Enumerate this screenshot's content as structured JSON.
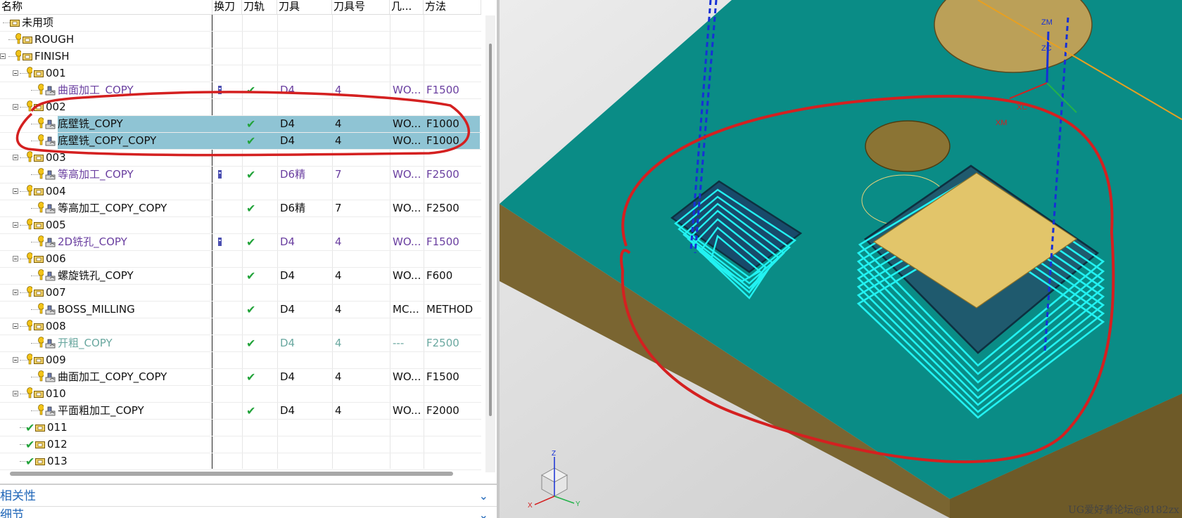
{
  "navigator": {
    "columns": [
      "名称",
      "换刀",
      "刀轨",
      "刀具",
      "刀具号",
      "几...",
      "方法"
    ],
    "rows": [
      {
        "name": "未用项",
        "level": 0,
        "expand": false,
        "bulb": false,
        "check": false,
        "kind": "folder",
        "color": "black",
        "tool_change": false,
        "path_ok": false,
        "tool": "",
        "tool_no": "",
        "geom": "",
        "method": ""
      },
      {
        "name": "ROUGH",
        "level": 1,
        "expand": false,
        "bulb": true,
        "check": false,
        "kind": "folder",
        "color": "black",
        "tool_change": false,
        "path_ok": false,
        "tool": "",
        "tool_no": "",
        "geom": "",
        "method": ""
      },
      {
        "name": "FINISH",
        "level": 1,
        "expand": true,
        "bulb": true,
        "check": false,
        "kind": "folder",
        "color": "black",
        "tool_change": false,
        "path_ok": false,
        "tool": "",
        "tool_no": "",
        "geom": "",
        "method": ""
      },
      {
        "name": "001",
        "level": 2,
        "expand": true,
        "bulb": true,
        "check": false,
        "kind": "folder",
        "color": "black",
        "tool_change": false,
        "path_ok": false,
        "tool": "",
        "tool_no": "",
        "geom": "",
        "method": ""
      },
      {
        "name": "曲面加工_COPY",
        "level": 3,
        "expand": false,
        "bulb": true,
        "check": false,
        "kind": "op",
        "color": "purple",
        "tool_change": true,
        "path_ok": true,
        "tool": "D4",
        "tool_no": "4",
        "geom": "WO...",
        "method": "F1500"
      },
      {
        "name": "002",
        "level": 2,
        "expand": true,
        "bulb": true,
        "check": false,
        "kind": "folder",
        "color": "black",
        "tool_change": false,
        "path_ok": false,
        "tool": "",
        "tool_no": "",
        "geom": "",
        "method": ""
      },
      {
        "name": "底壁铣_COPY",
        "level": 3,
        "expand": false,
        "bulb": true,
        "check": false,
        "kind": "op",
        "color": "black",
        "tool_change": false,
        "path_ok": true,
        "tool": "D4",
        "tool_no": "4",
        "geom": "WO...",
        "method": "F1000",
        "selected": true
      },
      {
        "name": "底壁铣_COPY_COPY",
        "level": 3,
        "expand": false,
        "bulb": true,
        "check": false,
        "kind": "op",
        "color": "black",
        "tool_change": false,
        "path_ok": true,
        "tool": "D4",
        "tool_no": "4",
        "geom": "WO...",
        "method": "F1000",
        "selected": true
      },
      {
        "name": "003",
        "level": 2,
        "expand": true,
        "bulb": true,
        "check": false,
        "kind": "folder",
        "color": "black",
        "tool_change": false,
        "path_ok": false,
        "tool": "",
        "tool_no": "",
        "geom": "",
        "method": ""
      },
      {
        "name": "等高加工_COPY",
        "level": 3,
        "expand": false,
        "bulb": true,
        "check": false,
        "kind": "op",
        "color": "purple",
        "tool_change": true,
        "path_ok": true,
        "tool": "D6精",
        "tool_no": "7",
        "geom": "WO...",
        "method": "F2500"
      },
      {
        "name": "004",
        "level": 2,
        "expand": true,
        "bulb": true,
        "check": false,
        "kind": "folder",
        "color": "black",
        "tool_change": false,
        "path_ok": false,
        "tool": "",
        "tool_no": "",
        "geom": "",
        "method": ""
      },
      {
        "name": "等高加工_COPY_COPY",
        "level": 3,
        "expand": false,
        "bulb": true,
        "check": false,
        "kind": "op",
        "color": "black",
        "tool_change": false,
        "path_ok": true,
        "tool": "D6精",
        "tool_no": "7",
        "geom": "WO...",
        "method": "F2500"
      },
      {
        "name": "005",
        "level": 2,
        "expand": true,
        "bulb": true,
        "check": false,
        "kind": "folder",
        "color": "black",
        "tool_change": false,
        "path_ok": false,
        "tool": "",
        "tool_no": "",
        "geom": "",
        "method": ""
      },
      {
        "name": "2D铣孔_COPY",
        "level": 3,
        "expand": false,
        "bulb": true,
        "check": false,
        "kind": "op",
        "color": "purple",
        "tool_change": true,
        "path_ok": true,
        "tool": "D4",
        "tool_no": "4",
        "geom": "WO...",
        "method": "F1500"
      },
      {
        "name": "006",
        "level": 2,
        "expand": true,
        "bulb": true,
        "check": false,
        "kind": "folder",
        "color": "black",
        "tool_change": false,
        "path_ok": false,
        "tool": "",
        "tool_no": "",
        "geom": "",
        "method": ""
      },
      {
        "name": "螺旋铣孔_COPY",
        "level": 3,
        "expand": false,
        "bulb": true,
        "check": false,
        "kind": "op",
        "color": "black",
        "tool_change": false,
        "path_ok": true,
        "tool": "D4",
        "tool_no": "4",
        "geom": "WO...",
        "method": "F600"
      },
      {
        "name": "007",
        "level": 2,
        "expand": true,
        "bulb": true,
        "check": false,
        "kind": "folder",
        "color": "black",
        "tool_change": false,
        "path_ok": false,
        "tool": "",
        "tool_no": "",
        "geom": "",
        "method": ""
      },
      {
        "name": "BOSS_MILLING",
        "level": 3,
        "expand": false,
        "bulb": true,
        "check": false,
        "kind": "op",
        "color": "black",
        "tool_change": false,
        "path_ok": true,
        "tool": "D4",
        "tool_no": "4",
        "geom": "MC...",
        "method": "METHOD"
      },
      {
        "name": "008",
        "level": 2,
        "expand": true,
        "bulb": true,
        "check": false,
        "kind": "folder",
        "color": "black",
        "tool_change": false,
        "path_ok": false,
        "tool": "",
        "tool_no": "",
        "geom": "",
        "method": ""
      },
      {
        "name": "开粗_COPY",
        "level": 3,
        "expand": false,
        "bulb": true,
        "check": false,
        "kind": "op",
        "color": "grey-green",
        "tool_change": false,
        "path_ok": true,
        "tool": "D4",
        "tool_no": "4",
        "geom": "---",
        "method": "F2500"
      },
      {
        "name": "009",
        "level": 2,
        "expand": true,
        "bulb": true,
        "check": false,
        "kind": "folder",
        "color": "black",
        "tool_change": false,
        "path_ok": false,
        "tool": "",
        "tool_no": "",
        "geom": "",
        "method": ""
      },
      {
        "name": "曲面加工_COPY_COPY",
        "level": 3,
        "expand": false,
        "bulb": true,
        "check": false,
        "kind": "op",
        "color": "black",
        "tool_change": false,
        "path_ok": true,
        "tool": "D4",
        "tool_no": "4",
        "geom": "WO...",
        "method": "F1500"
      },
      {
        "name": "010",
        "level": 2,
        "expand": true,
        "bulb": true,
        "check": false,
        "kind": "folder",
        "color": "black",
        "tool_change": false,
        "path_ok": false,
        "tool": "",
        "tool_no": "",
        "geom": "",
        "method": ""
      },
      {
        "name": "平面粗加工_COPY",
        "level": 3,
        "expand": false,
        "bulb": true,
        "check": false,
        "kind": "op",
        "color": "black",
        "tool_change": false,
        "path_ok": true,
        "tool": "D4",
        "tool_no": "4",
        "geom": "WO...",
        "method": "F2000"
      },
      {
        "name": "011",
        "level": 2,
        "expand": false,
        "bulb": false,
        "check": true,
        "kind": "folder",
        "color": "black",
        "tool_change": false,
        "path_ok": false,
        "tool": "",
        "tool_no": "",
        "geom": "",
        "method": ""
      },
      {
        "name": "012",
        "level": 2,
        "expand": false,
        "bulb": false,
        "check": true,
        "kind": "folder",
        "color": "black",
        "tool_change": false,
        "path_ok": false,
        "tool": "",
        "tool_no": "",
        "geom": "",
        "method": ""
      },
      {
        "name": "013",
        "level": 2,
        "expand": false,
        "bulb": false,
        "check": true,
        "kind": "folder",
        "color": "black",
        "tool_change": false,
        "path_ok": false,
        "tool": "",
        "tool_no": "",
        "geom": "",
        "method": ""
      }
    ]
  },
  "panels": {
    "dependencies": "相关性",
    "details": "细节"
  },
  "viewport": {
    "labels": {
      "xm": "XM",
      "xc": "XC",
      "zm": "ZM",
      "zc": "ZC",
      "axis_x": "X",
      "axis_y": "Y",
      "axis_z": "Z"
    },
    "watermark": "UG爱好者论坛@8182zx",
    "colors": {
      "teal": "#0a8c86",
      "gold": "#7e6a32",
      "cyan": "#18f0f0",
      "red": "#d42020",
      "blue": "#1730d6"
    }
  }
}
